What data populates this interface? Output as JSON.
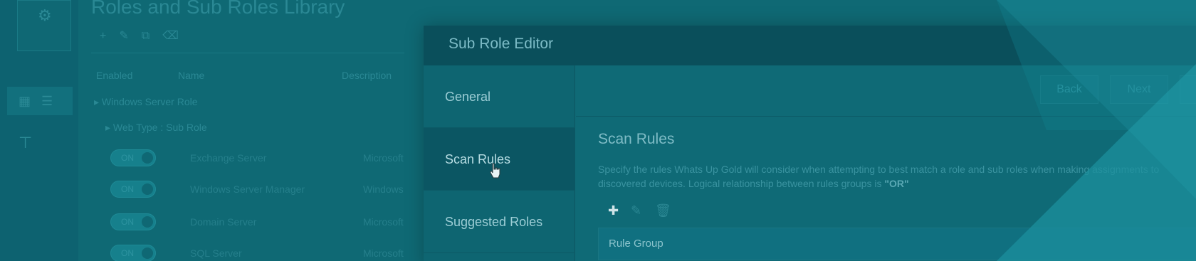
{
  "background": {
    "title": "Roles and Sub Roles Library",
    "rail_logo_text": "",
    "columns": [
      "Enabled",
      "Name",
      "Description"
    ],
    "tree_root": "Windows Server Role",
    "tree_child": "Web Type : Sub Role",
    "rows": [
      {
        "toggle": "ON",
        "name": "Exchange Server",
        "desc": "Microsoft"
      },
      {
        "toggle": "ON",
        "name": "Windows Server Manager",
        "desc": "Windows"
      },
      {
        "toggle": "ON",
        "name": "Domain Server",
        "desc": "Microsoft"
      },
      {
        "toggle": "ON",
        "name": "SQL Server",
        "desc": "Microsoft"
      }
    ]
  },
  "modal": {
    "title": "Sub Role Editor",
    "nav": [
      {
        "label": "General",
        "active": false
      },
      {
        "label": "Scan Rules",
        "active": true
      },
      {
        "label": "Suggested Roles",
        "active": false
      }
    ],
    "buttons": {
      "back": "Back",
      "next": "Next"
    },
    "section_title": "Scan Rules",
    "description_main": "Specify the rules Whats Up Gold will consider when attempting to best match a role and sub roles when making assignments to discovered devices. Logical relationship between rules groups is ",
    "description_emph": "\"OR\"",
    "rule_group_label": "Rule Group"
  },
  "icons": {
    "add": "plus-icon",
    "edit": "pencil-icon",
    "delete": "trash-icon",
    "cursor": "hand-pointer-icon"
  },
  "colors": {
    "overlay": "#0f6773",
    "header": "#0a4f5b",
    "active_nav": "#0b5663"
  }
}
